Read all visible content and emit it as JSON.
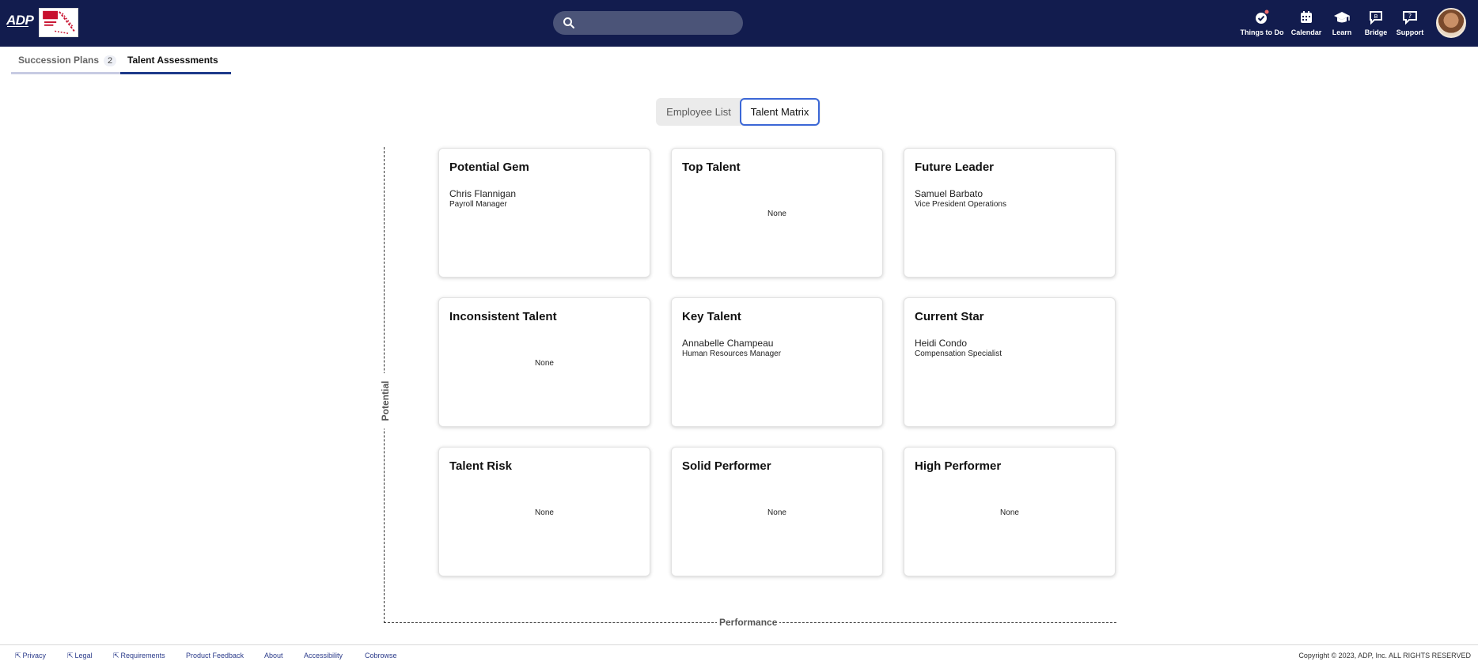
{
  "header": {
    "brand": "ADP",
    "search": {
      "placeholder": ""
    },
    "nav": [
      {
        "label": "Things to Do",
        "icon": "check-badge-icon"
      },
      {
        "label": "Calendar",
        "icon": "calendar-icon"
      },
      {
        "label": "Learn",
        "icon": "graduation-cap-icon"
      },
      {
        "label": "Bridge",
        "icon": "chat-bridge-icon"
      },
      {
        "label": "Support",
        "icon": "support-chat-icon"
      }
    ]
  },
  "tabs": {
    "succession_label": "Succession Plans",
    "succession_count": "2",
    "talent_label": "Talent Assessments"
  },
  "view_toggle": {
    "employee_list": "Employee List",
    "talent_matrix": "Talent Matrix",
    "selected": "Talent Matrix"
  },
  "matrix": {
    "y_axis_label": "Potential",
    "x_axis_label": "Performance",
    "cells": [
      {
        "title": "Potential Gem",
        "employees": [
          {
            "name": "Chris Flannigan",
            "role": "Payroll Manager"
          }
        ],
        "empty_text": ""
      },
      {
        "title": "Top Talent",
        "employees": [],
        "empty_text": "None"
      },
      {
        "title": "Future Leader",
        "employees": [
          {
            "name": "Samuel Barbato",
            "role": "Vice President Operations"
          }
        ],
        "empty_text": ""
      },
      {
        "title": "Inconsistent Talent",
        "employees": [],
        "empty_text": "None"
      },
      {
        "title": "Key Talent",
        "employees": [
          {
            "name": "Annabelle Champeau",
            "role": "Human Resources Manager"
          }
        ],
        "empty_text": ""
      },
      {
        "title": "Current Star",
        "employees": [
          {
            "name": "Heidi Condo",
            "role": "Compensation Specialist"
          }
        ],
        "empty_text": ""
      },
      {
        "title": "Talent Risk",
        "employees": [],
        "empty_text": "None"
      },
      {
        "title": "Solid Performer",
        "employees": [],
        "empty_text": "None"
      },
      {
        "title": "High Performer",
        "employees": [],
        "empty_text": "None"
      }
    ]
  },
  "footer": {
    "links": [
      "Privacy",
      "Legal",
      "Requirements",
      "Product Feedback",
      "About",
      "Accessibility",
      "Cobrowse"
    ],
    "copyright": "Copyright © 2023, ADP, Inc. ALL RIGHTS RESERVED"
  },
  "colors": {
    "nav_bg": "#121c4e",
    "accent": "#1e3a8a",
    "toggle_border": "#3b67d6"
  }
}
